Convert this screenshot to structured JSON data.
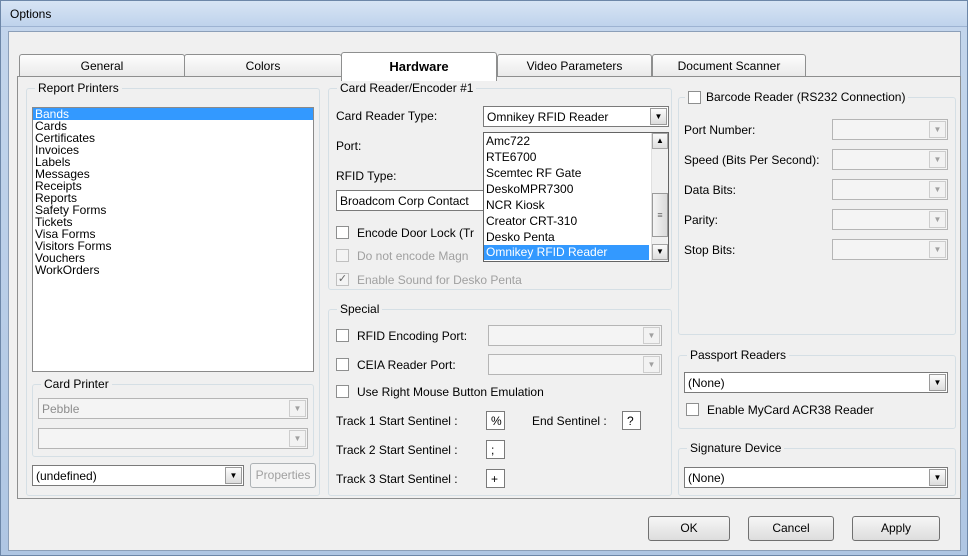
{
  "window": {
    "title": "Options"
  },
  "tabs": [
    "General",
    "Colors",
    "Hardware",
    "Video Parameters",
    "Document Scanner"
  ],
  "report_printers": {
    "legend": "Report Printers",
    "items": [
      "Bands",
      "Cards",
      "Certificates",
      "Invoices",
      "Labels",
      "Messages",
      "Receipts",
      "Reports",
      "Safety Forms",
      "Tickets",
      "Visa Forms",
      "Visitors Forms",
      "Vouchers",
      "WorkOrders"
    ],
    "selected": "Bands"
  },
  "card_printer": {
    "legend": "Card Printer",
    "printer_value": "Pebble",
    "second_value": "",
    "undefined_value": "(undefined)",
    "properties_label": "Properties"
  },
  "card_reader": {
    "legend": "Card Reader/Encoder #1",
    "type_label": "Card Reader Type:",
    "type_value": "Omnikey RFID Reader",
    "port_label": "Port:",
    "rfid_type_label": "RFID Type:",
    "rfid_type_value": "Broadcom Corp Contact",
    "encode_door_lock_label": "Encode Door Lock (Tr",
    "do_not_encode_label": "Do not encode Magn",
    "enable_sound_label": "Enable Sound for Desko Penta",
    "dropdown_options": [
      "Amc722",
      "RTE6700",
      "Scemtec RF Gate",
      "DeskoMPR7300",
      "NCR Kiosk",
      "Creator CRT-310",
      "Desko Penta",
      "Omnikey RFID Reader"
    ],
    "dropdown_selected": "Omnikey RFID Reader"
  },
  "special": {
    "legend": "Special",
    "rfid_encoding_port_label": "RFID Encoding Port:",
    "ceia_reader_port_label": "CEIA Reader Port:",
    "right_mouse_label": "Use Right Mouse Button Emulation",
    "track1_label": "Track 1 Start Sentinel :",
    "track1_value": "%",
    "end_sentinel_label": "End Sentinel :",
    "end_sentinel_value": "?",
    "track2_label": "Track 2 Start Sentinel :",
    "track2_value": ";",
    "track3_label": "Track 3 Start Sentinel :",
    "track3_value": "+"
  },
  "barcode_reader": {
    "legend": "Barcode Reader (RS232 Connection)",
    "port_number_label": "Port Number:",
    "speed_label": "Speed (Bits Per Second):",
    "data_bits_label": "Data Bits:",
    "parity_label": "Parity:",
    "stop_bits_label": "Stop Bits:"
  },
  "passport_readers": {
    "legend": "Passport Readers",
    "value": "(None)",
    "enable_mycard_label": "Enable MyCard ACR38 Reader"
  },
  "signature_device": {
    "legend": "Signature Device",
    "value": "(None)"
  },
  "buttons": {
    "ok": "OK",
    "cancel": "Cancel",
    "apply": "Apply"
  },
  "colors": {
    "selection": "#3399ff",
    "dialog_bg": "#f0f0f0",
    "title_bar": "#c4d6ec"
  }
}
